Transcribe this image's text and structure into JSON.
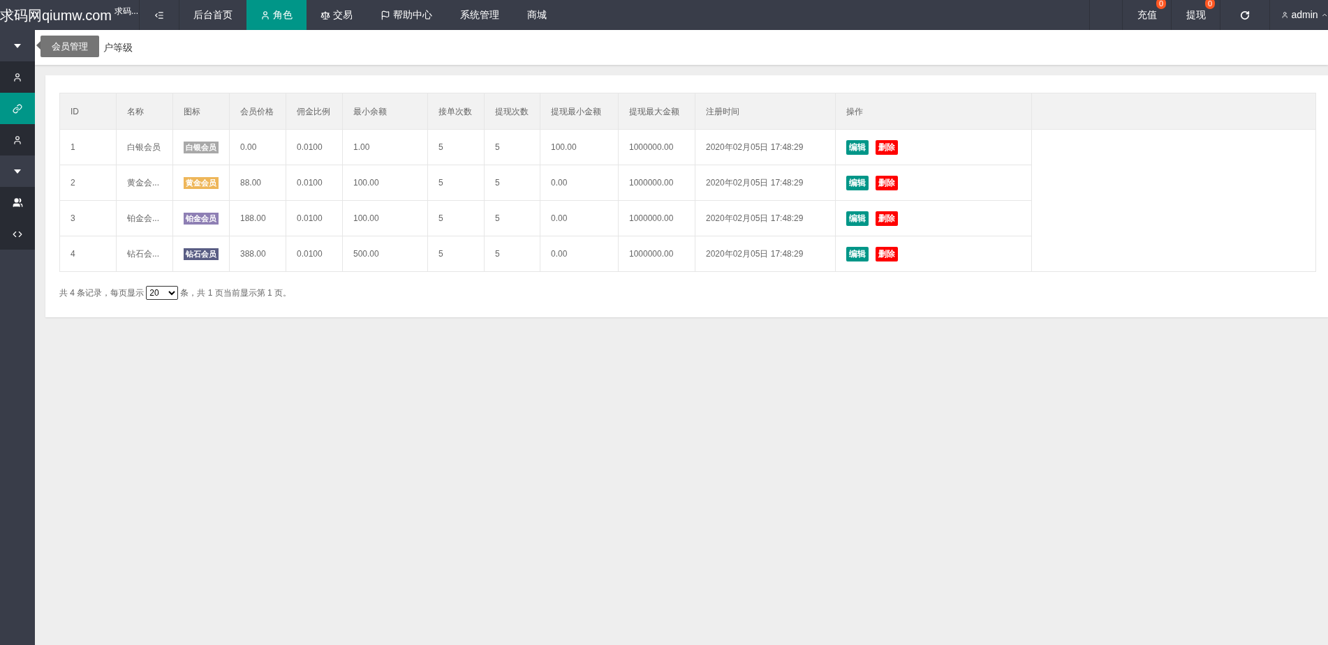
{
  "header": {
    "logo": "求码网qiumw.com",
    "logo_sup": "求码...",
    "nav": [
      {
        "label": "后台首页",
        "selected": false
      },
      {
        "label": "角色",
        "selected": true
      },
      {
        "label": "交易",
        "selected": false
      },
      {
        "label": "帮助中心",
        "selected": false
      },
      {
        "label": "系统管理",
        "selected": false
      },
      {
        "label": "商城",
        "selected": false
      }
    ],
    "actions": [
      {
        "kind": "badge",
        "label": "充值",
        "count": "0"
      },
      {
        "kind": "badge",
        "label": "提现",
        "count": "0"
      },
      {
        "kind": "refresh"
      },
      {
        "kind": "user",
        "label": "admin"
      }
    ]
  },
  "sidebar": {
    "items": [
      {
        "kind": "group",
        "selected": false
      },
      {
        "kind": "item",
        "selected": false
      },
      {
        "kind": "item",
        "selected": true
      },
      {
        "kind": "item",
        "selected": false
      },
      {
        "kind": "group",
        "selected": false
      },
      {
        "kind": "item",
        "selected": false
      },
      {
        "kind": "item",
        "selected": false
      }
    ]
  },
  "tooltip": "会员管理",
  "breadcrumb": "户等级",
  "table": {
    "columns": [
      "ID",
      "名称",
      "图标",
      "会员价格",
      "佣金比例",
      "最小余额",
      "接单次数",
      "提现次数",
      "提现最小金额",
      "提现最大金额",
      "注册时间",
      "操作"
    ],
    "rows": [
      {
        "id": "1",
        "name": "白银会员",
        "badge": "白银会员",
        "color": "#a8a8a8",
        "price": "0.00",
        "ratio": "0.0100",
        "min_balance": "1.00",
        "orders": "5",
        "withdrawals": "5",
        "min_withdraw": "100.00",
        "max_withdraw": "1000000.00",
        "time": "2020年02月05日 17:48:29",
        "actions": [
          "编辑",
          "删除"
        ]
      },
      {
        "id": "2",
        "name": "黄金会...",
        "badge": "黄金会员",
        "color": "#eeb659",
        "price": "88.00",
        "ratio": "0.0100",
        "min_balance": "100.00",
        "orders": "5",
        "withdrawals": "5",
        "min_withdraw": "0.00",
        "max_withdraw": "1000000.00",
        "time": "2020年02月05日 17:48:29",
        "actions": [
          "编辑",
          "删除"
        ]
      },
      {
        "id": "3",
        "name": "铂金会...",
        "badge": "铂金会员",
        "color": "#8e7fb4",
        "price": "188.00",
        "ratio": "0.0100",
        "min_balance": "100.00",
        "orders": "5",
        "withdrawals": "5",
        "min_withdraw": "0.00",
        "max_withdraw": "1000000.00",
        "time": "2020年02月05日 17:48:29",
        "actions": [
          "编辑",
          "删除"
        ]
      },
      {
        "id": "4",
        "name": "钻石会...",
        "badge": "钻石会员",
        "color": "#595d84",
        "price": "388.00",
        "ratio": "0.0100",
        "min_balance": "500.00",
        "orders": "5",
        "withdrawals": "5",
        "min_withdraw": "0.00",
        "max_withdraw": "1000000.00",
        "time": "2020年02月05日 17:48:29",
        "actions": [
          "编辑",
          "删除"
        ]
      }
    ]
  },
  "pagination": {
    "before": "共 4 条记录，每页显示",
    "page_size": "20",
    "after": "条，共 1 页当前显示第 1 页。"
  }
}
